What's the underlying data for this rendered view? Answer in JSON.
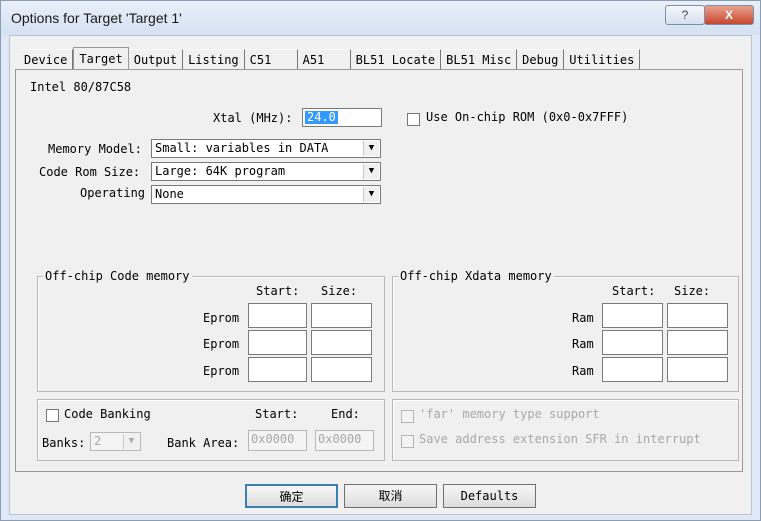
{
  "window": {
    "title": "Options for Target 'Target 1'",
    "help_label": "?",
    "close_label": "X"
  },
  "tabs": [
    "Device",
    "Target",
    "Output",
    "Listing",
    "C51",
    "A51",
    "BL51 Locate",
    "BL51 Misc",
    "Debug",
    "Utilities"
  ],
  "active_tab": "Target",
  "target": {
    "device_name": "Intel 80/87C58",
    "xtal_label": "Xtal (MHz):",
    "xtal_value": "24.0",
    "use_onchip_rom_label": "Use On-chip ROM (0x0-0x7FFF)",
    "memory_model_label": "Memory Model:",
    "memory_model_value": "Small: variables in DATA",
    "code_rom_size_label": "Code Rom Size:",
    "code_rom_size_value": "Large: 64K program",
    "operating_label": "Operating",
    "operating_value": "None"
  },
  "offchip_code": {
    "title": "Off-chip Code memory",
    "start_header": "Start:",
    "size_header": "Size:",
    "rows": [
      {
        "label": "Eprom"
      },
      {
        "label": "Eprom"
      },
      {
        "label": "Eprom"
      }
    ]
  },
  "offchip_xdata": {
    "title": "Off-chip Xdata memory",
    "start_header": "Start:",
    "size_header": "Size:",
    "rows": [
      {
        "label": "Ram"
      },
      {
        "label": "Ram"
      },
      {
        "label": "Ram"
      }
    ]
  },
  "banking": {
    "code_banking_label": "Code Banking",
    "start_header": "Start:",
    "end_header": "End:",
    "banks_label": "Banks:",
    "banks_value": "2",
    "bank_area_label": "Bank Area:",
    "bank_start": "0x0000",
    "bank_end": "0x0000"
  },
  "extras": {
    "far_memory_label": "'far' memory type support",
    "save_address_label": "Save address extension SFR in interrupt"
  },
  "buttons": {
    "ok": "确定",
    "cancel": "取消",
    "defaults": "Defaults"
  }
}
